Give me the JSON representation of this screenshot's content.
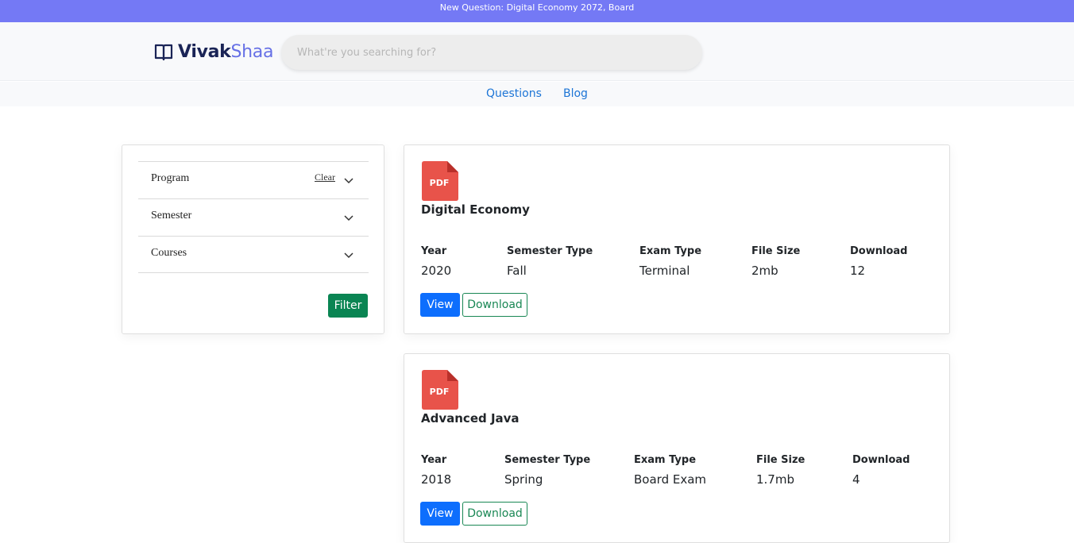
{
  "announcement": "New Question: Digital Economy 2072, Board",
  "brand": {
    "bold": "Vivak",
    "light": "Shaa"
  },
  "search": {
    "placeholder": "What're you searching for?"
  },
  "nav": [
    "Questions",
    "Blog"
  ],
  "filters": {
    "rows": [
      {
        "label": "Program",
        "clear": "Clear"
      },
      {
        "label": "Semester"
      },
      {
        "label": "Courses"
      }
    ],
    "button": "Filter"
  },
  "labels": {
    "year": "Year",
    "semester_type": "Semester Type",
    "exam_type": "Exam Type",
    "file_size": "File Size",
    "download": "Download",
    "pdf": "PDF",
    "view_btn": "View",
    "download_btn": "Download"
  },
  "papers": [
    {
      "title": "Digital Economy",
      "year": "2020",
      "semester_type": "Fall",
      "exam_type": "Terminal",
      "file_size": "2mb",
      "downloads": "12"
    },
    {
      "title": "Advanced Java",
      "year": "2018",
      "semester_type": "Spring",
      "exam_type": "Board Exam",
      "file_size": "1.7mb",
      "downloads": "4"
    }
  ],
  "colors": {
    "announcement_bg": "#7479f5",
    "brand_dark": "#1a2456",
    "brand_accent": "#6670e6",
    "link": "#1d75d6",
    "filter_btn": "#0a8553",
    "view_btn": "#0d6efd",
    "download_btn": "#198754",
    "pdf_icon": "#e8534a"
  },
  "icons": {
    "logo": "open-book-icon",
    "chevron": "chevron-down-icon",
    "file": "pdf-file-icon"
  }
}
